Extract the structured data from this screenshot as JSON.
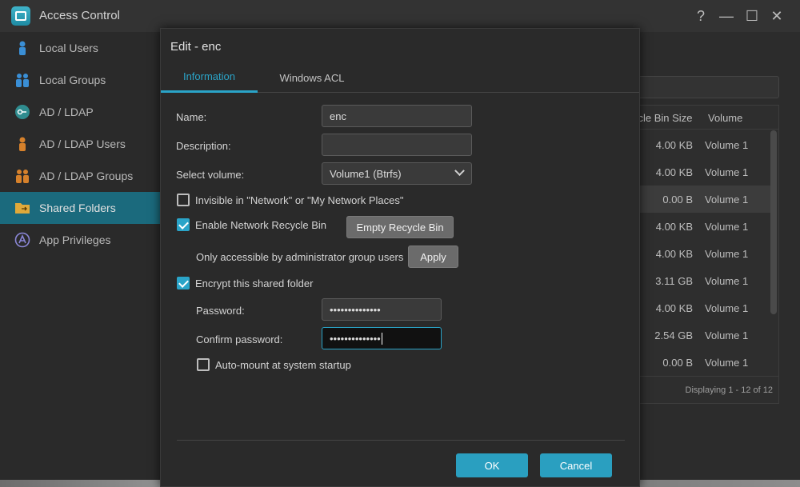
{
  "app": {
    "title": "Access Control"
  },
  "window_controls": {
    "help": "?",
    "minimize": "—",
    "maximize": "☐",
    "close": "✕"
  },
  "sidebar": {
    "items": [
      {
        "label": "Local Users",
        "icon": "user-icon"
      },
      {
        "label": "Local Groups",
        "icon": "users-icon"
      },
      {
        "label": "AD / LDAP",
        "icon": "key-icon"
      },
      {
        "label": "AD / LDAP Users",
        "icon": "user-icon"
      },
      {
        "label": "AD / LDAP Groups",
        "icon": "users-icon"
      },
      {
        "label": "Shared Folders",
        "icon": "folder-icon"
      },
      {
        "label": "App Privileges",
        "icon": "app-icon"
      }
    ],
    "active_index": 5
  },
  "background_table": {
    "headers": [
      "ycle Bin Size",
      "Volume"
    ],
    "rows": [
      {
        "size": "4.00 KB",
        "volume": "Volume 1"
      },
      {
        "size": "4.00 KB",
        "volume": "Volume 1"
      },
      {
        "size": "0.00 B",
        "volume": "Volume 1"
      },
      {
        "size": "4.00 KB",
        "volume": "Volume 1"
      },
      {
        "size": "4.00 KB",
        "volume": "Volume 1"
      },
      {
        "size": "3.11 GB",
        "volume": "Volume 1"
      },
      {
        "size": "4.00 KB",
        "volume": "Volume 1"
      },
      {
        "size": "2.54 GB",
        "volume": "Volume 1"
      },
      {
        "size": "0.00 B",
        "volume": "Volume 1"
      }
    ],
    "footer": "Displaying 1 - 12 of 12"
  },
  "dialog": {
    "title": "Edit - enc",
    "tabs": [
      "Information",
      "Windows ACL"
    ],
    "active_tab": 0,
    "name_label": "Name:",
    "name_value": "enc",
    "description_label": "Description:",
    "description_value": "",
    "volume_label": "Select volume:",
    "volume_value": "Volume1 (Btrfs)",
    "invisible_label": "Invisible in \"Network\" or \"My Network Places\"",
    "invisible_checked": false,
    "recycle_label": "Enable Network Recycle Bin",
    "recycle_checked": true,
    "empty_recycle_button": "Empty Recycle Bin",
    "admin_only_label": "Only accessible by administrator group users",
    "apply_button": "Apply",
    "encrypt_label": "Encrypt this shared folder",
    "encrypt_checked": true,
    "password_label": "Password:",
    "password_value": "••••••••••••••",
    "confirm_label": "Confirm password:",
    "confirm_value": "••••••••••••••",
    "automount_label": "Auto-mount at system startup",
    "automount_checked": false,
    "ok_button": "OK",
    "cancel_button": "Cancel"
  },
  "colors": {
    "accent": "#2aa4c8",
    "sidebar_active": "#1b6a7d"
  }
}
